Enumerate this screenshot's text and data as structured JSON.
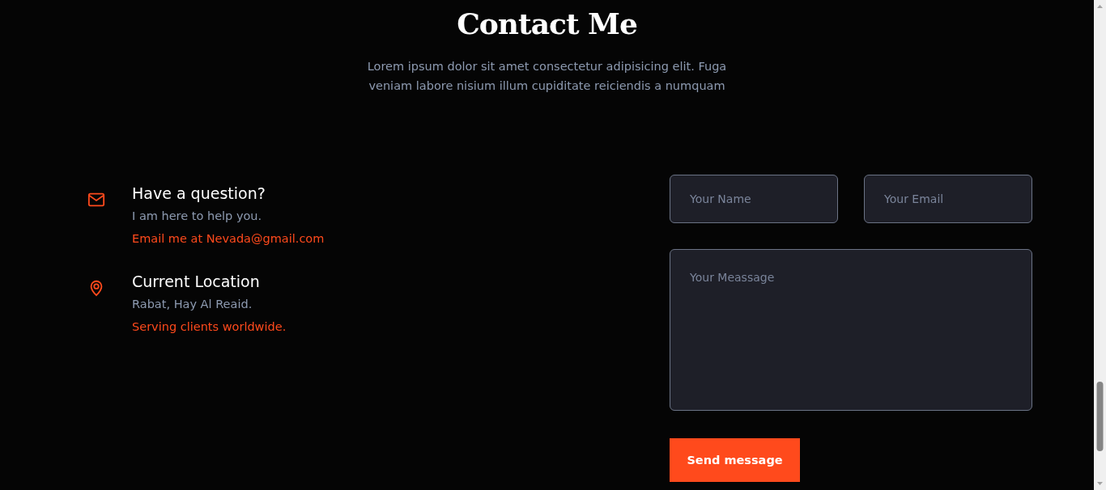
{
  "heading": "Contact Me",
  "intro": "Lorem ipsum dolor sit amet consectetur adipisicing elit. Fuga veniam labore nisium illum cupiditate reiciendis a numquam",
  "contact_items": [
    {
      "kind": "email",
      "title": "Have a question?",
      "text": "I am here to help you.",
      "highlight": "Email me at Nevada@gmail.com"
    },
    {
      "kind": "location",
      "title": "Current Location",
      "text": "Rabat, Hay Al Reaid.",
      "highlight": "Serving clients worldwide."
    }
  ],
  "form": {
    "name_field": {
      "placeholder": "Your Name"
    },
    "email_field": {
      "placeholder": "Your Email"
    },
    "message_field": {
      "placeholder": "Your Meassage"
    },
    "submit_button": "Send message"
  }
}
